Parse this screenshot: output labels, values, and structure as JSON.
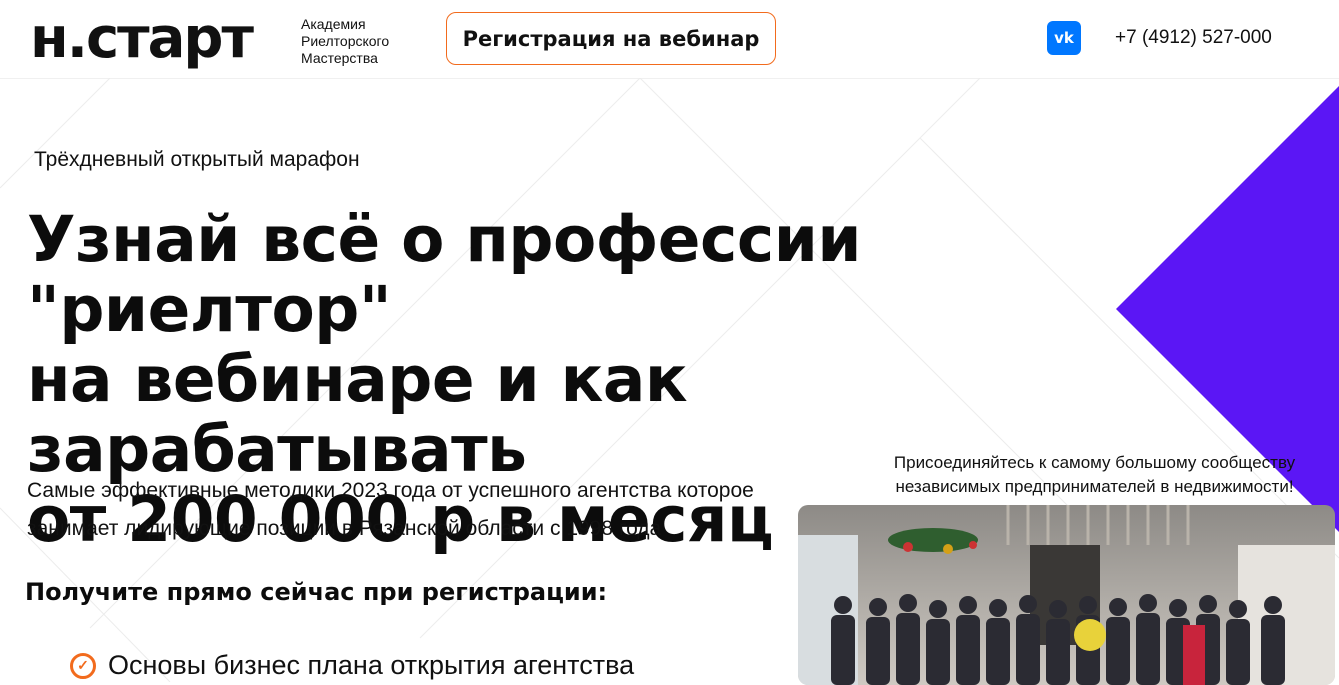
{
  "header": {
    "logo_text": "н.старт",
    "logo_sub": [
      "Академия",
      "Риелторского",
      "Мастерства"
    ],
    "register_button": "Регистрация на вебинар",
    "vk_icon": "vk-icon",
    "vk_label": "vk",
    "phone": "+7 (4912) 527-000"
  },
  "hero": {
    "eyebrow": "Трёхдневный открытый марафон",
    "headline": [
      "Узнай всё о профессии \"риелтор\"",
      "на вебинаре и как зарабатывать",
      "от 200 000 р в месяц"
    ],
    "description": [
      "Самые эффективные методики 2023 года от успешного агентства которое",
      "занимает лидирующие позиции в Рязанской области с 1998 года"
    ],
    "get_now": "Получите прямо сейчас при регистрации:",
    "bullets": [
      "Основы бизнес плана открытия агентства"
    ]
  },
  "community": {
    "text": [
      "Присоединяйтесь к самому большому сообществу",
      "независимых предпринимателей в недвижимости!"
    ]
  },
  "colors": {
    "accent": "#f26b1d",
    "purple": "#5b16f5",
    "vk": "#0077ff"
  }
}
